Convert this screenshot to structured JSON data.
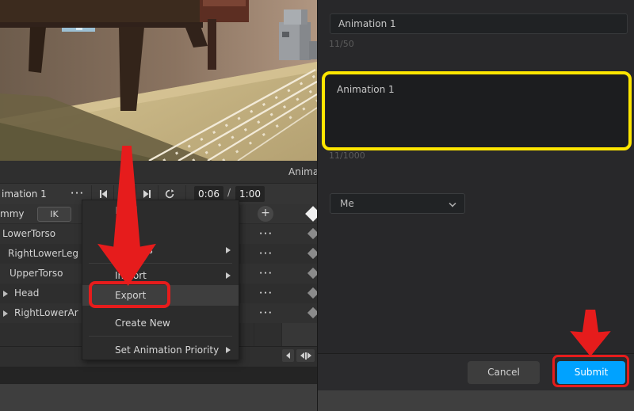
{
  "colors": {
    "accent_blue": "#00a2ff",
    "annotation_red": "#e61c1c",
    "annotation_yellow": "#ffe600",
    "editor_bg": "#2e2e2e",
    "dialog_bg": "#28282a"
  },
  "left_editor": {
    "panel_title_clipped": "Anima",
    "toolbar": {
      "clip_name": "imation 1",
      "menu_dots": "···",
      "time_current": "0:06",
      "time_separator": "/",
      "time_total": "1:00",
      "add_track_label": "+"
    },
    "rig_row": {
      "name": "mmy",
      "ik_label": "IK"
    },
    "row_dots": "···",
    "tracks": [
      {
        "name": "LowerTorso"
      },
      {
        "name": "RightLowerLeg"
      },
      {
        "name": "UpperTorso"
      },
      {
        "name": "Head"
      },
      {
        "name": "RightLowerAr"
      }
    ],
    "context_menu": {
      "items": [
        {
          "label": "Load",
          "disabled": true
        },
        {
          "label": "Save"
        },
        {
          "label": "Save As",
          "submenu": true
        },
        {
          "label": "Import",
          "submenu": true
        },
        {
          "label": "Export",
          "highlighted": true
        },
        {
          "label": "Create New"
        },
        {
          "label": "Set Animation Priority",
          "submenu": true
        }
      ]
    }
  },
  "export_dialog": {
    "name_field": {
      "value": "Animation 1",
      "counter": "11/50"
    },
    "description_field": {
      "value": "Animation 1",
      "counter": "11/1000"
    },
    "owner_dropdown": {
      "value": "Me"
    },
    "buttons": {
      "cancel": "Cancel",
      "submit": "Submit"
    }
  }
}
